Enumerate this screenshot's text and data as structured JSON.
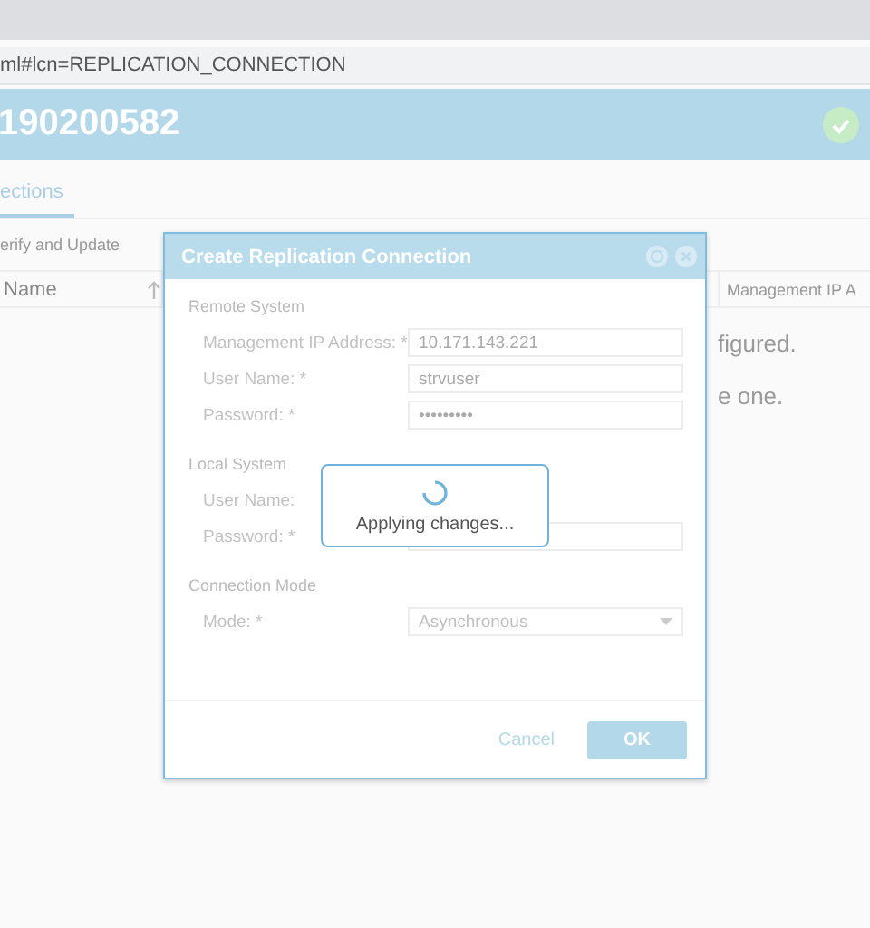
{
  "address_bar": {
    "url": "ml#lcn=REPLICATION_CONNECTION"
  },
  "header": {
    "title": "190200582"
  },
  "tabs": [
    {
      "label": "ections",
      "selected": true
    }
  ],
  "toolbar": {
    "action": "erify and Update"
  },
  "table": {
    "columns": [
      {
        "label": "Name",
        "sorted": true
      },
      {
        "label": "Management IP A",
        "sorted": false
      }
    ],
    "message_lines": [
      "figured.",
      "e one."
    ]
  },
  "dialog": {
    "title": "Create Replication Connection",
    "sections": [
      {
        "heading": "Remote System",
        "fields": [
          {
            "label": "Management IP Address: *",
            "kind": "text",
            "value": "10.171.143.221"
          },
          {
            "label": "User Name: *",
            "kind": "text",
            "value": "strvuser"
          },
          {
            "label": "Password: *",
            "kind": "text",
            "value": "•••••••••"
          }
        ]
      },
      {
        "heading": "Local System",
        "fields": [
          {
            "label": "User Name:",
            "kind": "hidden"
          },
          {
            "label": "Password: *",
            "kind": "text"
          }
        ]
      },
      {
        "heading": "Connection Mode",
        "fields": [
          {
            "label": "Mode: *",
            "kind": "select",
            "value": "Asynchronous"
          }
        ]
      }
    ],
    "buttons": [
      {
        "label": "Cancel",
        "kind": "link"
      },
      {
        "label": "OK",
        "kind": "primary"
      }
    ]
  },
  "loading": {
    "message": "Applying changes..."
  }
}
